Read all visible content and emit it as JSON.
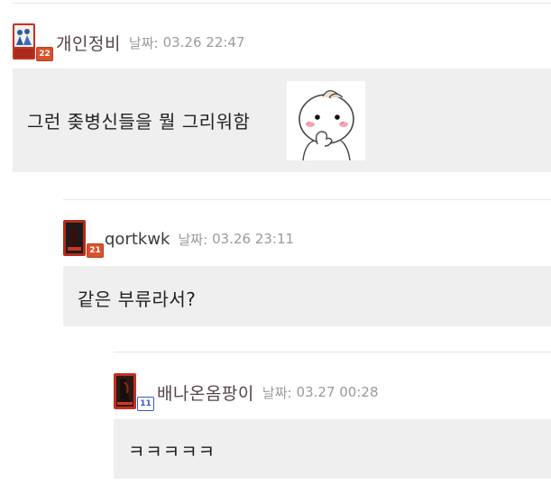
{
  "comments": [
    {
      "author": "개인정비",
      "date_label": "날짜:",
      "date": "03.26 22:47",
      "level_badge": "22",
      "text": "그런 좆병신들을 뭘 그리워함",
      "has_emoticon": true
    },
    {
      "author": "qortkwk",
      "date_label": "날짜:",
      "date": "03.26 23:11",
      "level_badge": "21",
      "text": "같은 부류라서?"
    },
    {
      "author": "배나온옴팡이",
      "date_label": "날짜:",
      "date": "03.27 00:28",
      "level_badge": "11",
      "text": "ㅋㅋㅋㅋㅋ"
    }
  ],
  "colors": {
    "comment_bg": "#efefef",
    "divider": "#e6e6e6",
    "author_text": "#55434a",
    "date_text": "#9a9a9a",
    "badge_red": "#d9522c",
    "badge_blue": "#3558c9"
  },
  "icons": {
    "emoticon": "blushing-thinking-face-emoticon",
    "avatar": "card-avatar-icon"
  }
}
